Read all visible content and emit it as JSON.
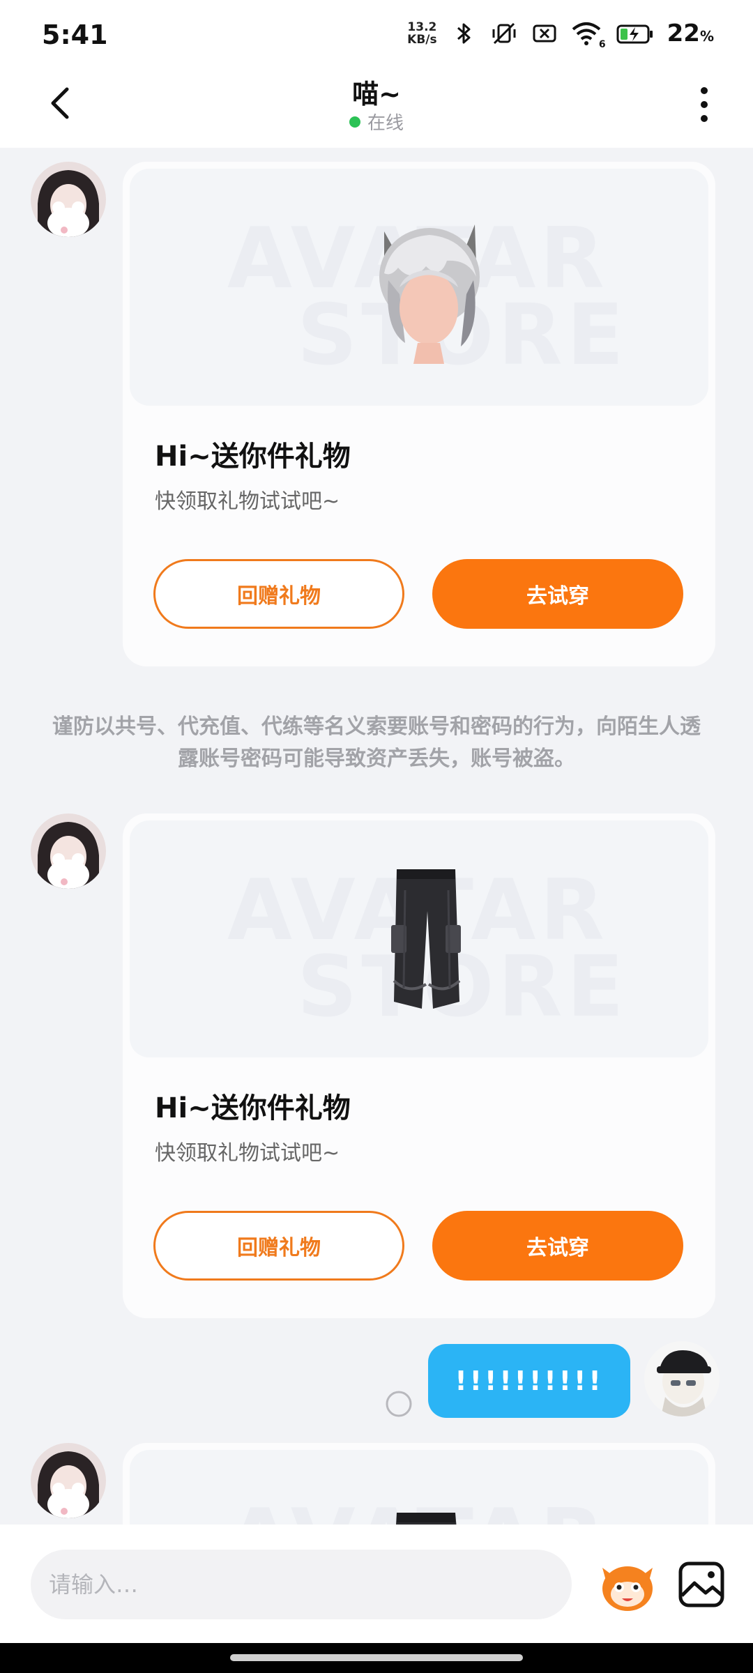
{
  "status_bar": {
    "time": "5:41",
    "net_speed_value": "13.2",
    "net_speed_unit": "KB/s",
    "wifi_badge": "6",
    "battery_percent": "22",
    "battery_percent_sign": "%",
    "icons": [
      "bluetooth-icon",
      "mute-vibrate-icon",
      "sim-off-icon",
      "wifi-icon",
      "battery-charging-icon"
    ]
  },
  "header": {
    "title": "喵~",
    "status": "在线",
    "status_color": "#2bc255",
    "back_icon": "chevron-left-icon",
    "more_icon": "more-vertical-icon"
  },
  "messages": [
    {
      "type": "gift_card",
      "item": "silver-cat-ear-hair",
      "title": "Hi~送你件礼物",
      "subtitle": "快领取礼物试试吧~",
      "return_gift_label": "回赠礼物",
      "try_on_label": "去试穿"
    },
    {
      "type": "system_notice",
      "text": "谨防以共号、代充值、代练等名义索要账号和密码的行为，向陌生人透露账号密码可能导致资产丢失，账号被盗。"
    },
    {
      "type": "gift_card",
      "item": "black-cargo-pants",
      "title": "Hi~送你件礼物",
      "subtitle": "快领取礼物试试吧~",
      "return_gift_label": "回赠礼物",
      "try_on_label": "去试穿"
    },
    {
      "type": "my_text",
      "text": "!!!!!!!!!!"
    },
    {
      "type": "gift_card",
      "item": "partial-card"
    }
  ],
  "watermark": [
    "AVATAR",
    "STORE"
  ],
  "input_bar": {
    "placeholder": "请输入…",
    "emoji_icon": "mascot-icon",
    "image_icon": "image-icon"
  },
  "colors": {
    "accent_orange": "#fb760f",
    "bubble_blue": "#2bb4f5",
    "background": "#f2f3f6"
  }
}
